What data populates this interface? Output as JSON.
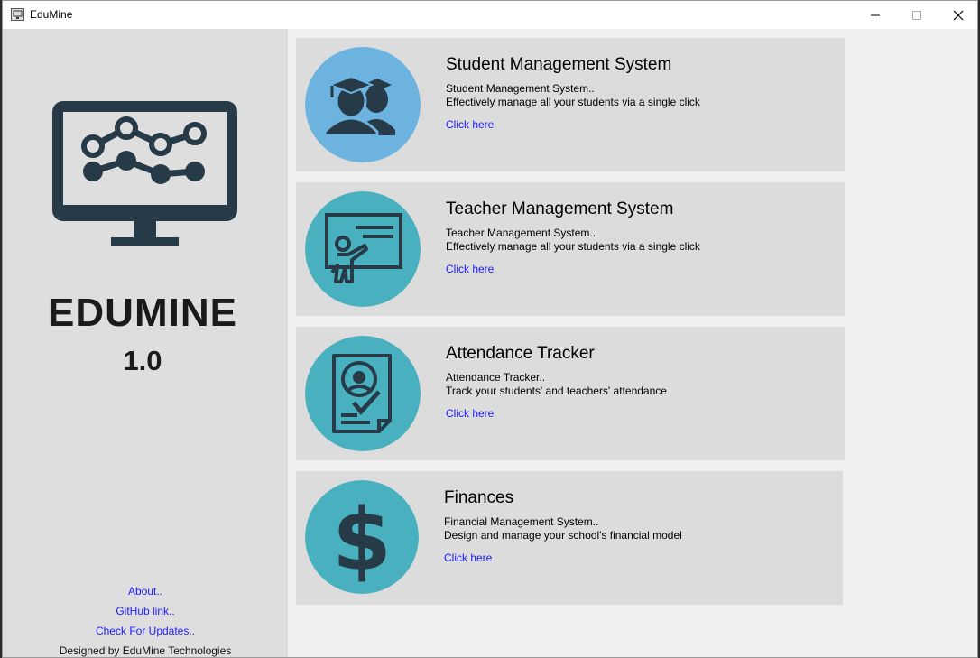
{
  "window": {
    "title": "EduMine",
    "icon": "app-icon",
    "controls": [
      "minimize-icon",
      "maximize-icon",
      "close-icon"
    ]
  },
  "sidebar": {
    "logo_icon": "monitor-chart-icon",
    "app_name": "EDUMINE",
    "version": "1.0",
    "links": {
      "about": "About..",
      "github": "GitHub link..",
      "updates": "Check For Updates.."
    },
    "credit": "Designed by EduMine Technologies"
  },
  "colors": {
    "sidebar_bg": "#dedede",
    "card_bg": "#dcdcdc",
    "icon_dark": "#263a48",
    "student_circle": "#6db3e0",
    "teal_circle": "#48b0bf",
    "link": "#1a1aff"
  },
  "cards": [
    {
      "title": "Student Management System",
      "subtitle": "Student Management System..",
      "description": "Effectively manage all your students via a single click",
      "link": "Click here",
      "icon": "graduates-icon"
    },
    {
      "title": "Teacher Management System",
      "subtitle": "Teacher Management System..",
      "description": "Effectively manage all your students via a single click",
      "link": "Click here",
      "icon": "teacher-board-icon"
    },
    {
      "title": "Attendance Tracker",
      "subtitle": "Attendance Tracker..",
      "description": "Track your students' and teachers' attendance",
      "link": "Click here",
      "icon": "attendance-document-icon"
    },
    {
      "title": "Finances",
      "subtitle": "Financial Management System..",
      "description": "Design and manage your school's financial model",
      "link": "Click here",
      "icon": "dollar-icon"
    }
  ]
}
